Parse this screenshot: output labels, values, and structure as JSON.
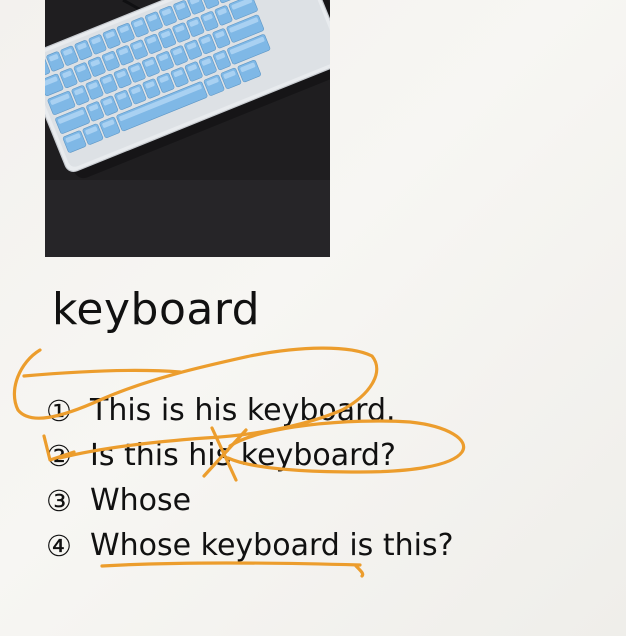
{
  "vocab": {
    "word": "keyboard",
    "image_icon": "keyboard-photo"
  },
  "sentences": [
    {
      "num": "①",
      "text": "This is his keyboard."
    },
    {
      "num": "②",
      "text": "Is this his keyboard?"
    },
    {
      "num": "③",
      "text": "Whose"
    },
    {
      "num": "④",
      "text": "Whose keyboard is this?"
    }
  ],
  "colors": {
    "annotation": "#ec9d2d",
    "keycap": "#7fb8e6",
    "keyboard_body": "#e8ebee",
    "photo_background": "#1f1e20"
  }
}
